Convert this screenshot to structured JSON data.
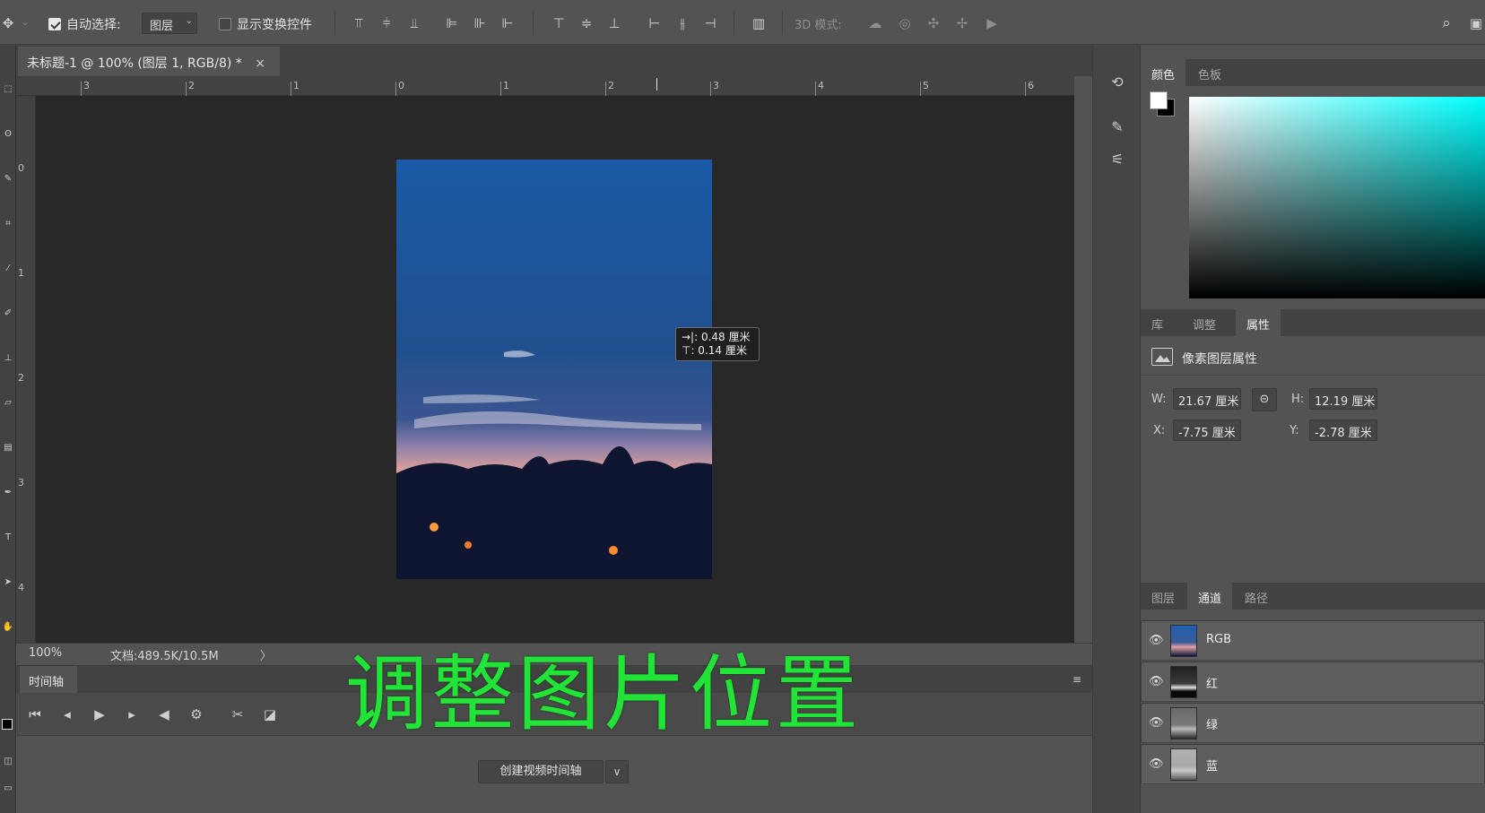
{
  "options_bar": {
    "auto_select_label": "自动选择:",
    "auto_select_checked": true,
    "auto_select_target": "图层",
    "show_transform_label": "显示变换控件",
    "show_transform_checked": false,
    "mode_3d_label": "3D 模式:"
  },
  "document": {
    "tab_title": "未标题-1 @ 100% (图层 1, RGB/8) *",
    "close_glyph": "×",
    "ruler_top_numbers": [
      "3",
      "2",
      "1",
      "0",
      "1",
      "2",
      "3",
      "4",
      "5",
      "6"
    ],
    "ruler_left_numbers": [
      "0",
      "1",
      "2",
      "3",
      "4"
    ],
    "tooltip_line1": "→|: 0.48 厘米",
    "tooltip_line2": "⊤: 0.14 厘米",
    "zoom": "100%",
    "doc_info": "文档:489.5K/10.5M",
    "status_arrow": "〉"
  },
  "timeline": {
    "tab_label": "时间轴",
    "create_button": "创建视频时间轴"
  },
  "overlay_text": "调整图片位置",
  "color_panel": {
    "tabs": [
      "颜色",
      "色板"
    ],
    "active_tab": 0
  },
  "properties_panel": {
    "tabs": [
      "库",
      "调整",
      "属性"
    ],
    "active_tab": 2,
    "title": "像素图层属性",
    "w_label": "W:",
    "w_value": "21.67 厘米",
    "h_label": "H:",
    "h_value": "12.19 厘米",
    "x_label": "X:",
    "x_value": "-7.75 厘米",
    "y_label": "Y:",
    "y_value": "-2.78 厘米"
  },
  "channels_panel": {
    "tabs": [
      "图层",
      "通道",
      "路径"
    ],
    "active_tab": 1,
    "channels": [
      "RGB",
      "红",
      "绿",
      "蓝"
    ]
  }
}
